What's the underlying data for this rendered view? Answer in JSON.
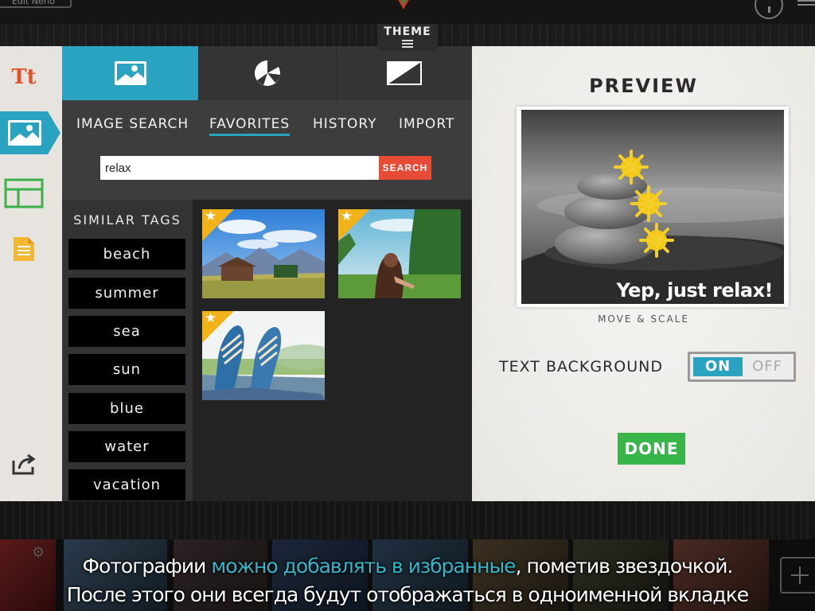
{
  "topbar": {
    "edit_label": "Edit Nerio",
    "theme_label": "THEME"
  },
  "tools": [
    {
      "name": "text-tool",
      "label": "Tt"
    },
    {
      "name": "image-tool"
    },
    {
      "name": "layout-tool"
    },
    {
      "name": "notes-tool"
    },
    {
      "name": "share-tool"
    }
  ],
  "panel": {
    "subtabs": [
      "IMAGE SEARCH",
      "FAVORITES",
      "HISTORY",
      "IMPORT"
    ],
    "active_subtab": "FAVORITES",
    "search": {
      "value": "relax",
      "button_label": "SEARCH"
    },
    "tags_title": "SIMILAR TAGS",
    "tags": [
      "beach",
      "summer",
      "sea",
      "sun",
      "blue",
      "water",
      "vacation"
    ],
    "results": [
      {
        "subject": "mountain-cabin",
        "favorite": true
      },
      {
        "subject": "girl-in-meadow",
        "favorite": true
      },
      {
        "subject": "sneakers-on-grass",
        "favorite": true
      }
    ]
  },
  "preview": {
    "title": "PREVIEW",
    "overlay_text": "Yep, just relax!",
    "move_scale": "MOVE & SCALE",
    "text_background_label": "TEXT BACKGROUND",
    "toggle": {
      "on": "ON",
      "off": "OFF",
      "state": "ON"
    },
    "done_label": "DONE"
  },
  "caption": {
    "line1_a": "Фотографии ",
    "line1_highlight": "можно добавлять в избранные",
    "line1_b": ", пометив звездочкой.",
    "line2": "После этого они всегда будут отображаться в одноименной вкладке"
  },
  "colors": {
    "accent": "#29a3c0",
    "search": "#e74a35",
    "done": "#38b549",
    "star": "#f1b21a",
    "text_tool": "#e3512c"
  }
}
